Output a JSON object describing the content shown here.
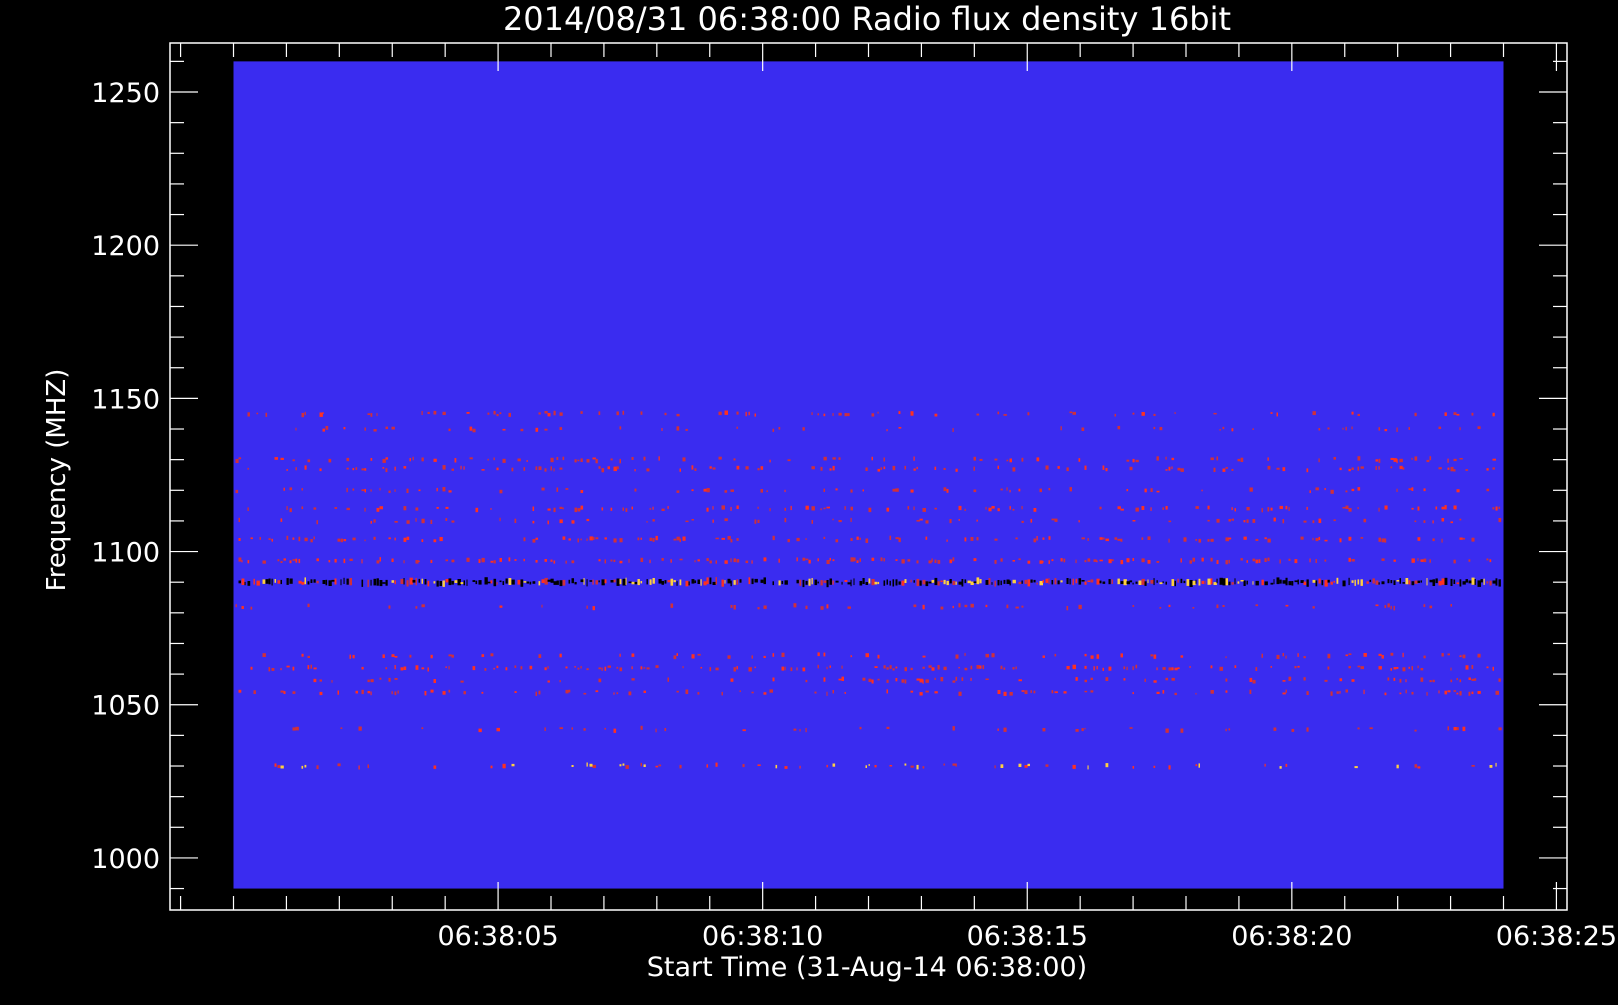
{
  "chart_data": {
    "type": "heatmap",
    "title": "2014/08/31 06:38:00 Radio flux density 16bit",
    "xlabel": "Start Time (31-Aug-14 06:38:00)",
    "ylabel": "Frequency (MHZ)",
    "x_ticks": [
      {
        "seconds": 5,
        "label": "06:38:05"
      },
      {
        "seconds": 10,
        "label": "06:38:10"
      },
      {
        "seconds": 15,
        "label": "06:38:15"
      },
      {
        "seconds": 20,
        "label": "06:38:20"
      },
      {
        "seconds": 25,
        "label": "06:38:25"
      }
    ],
    "x_minor_step_seconds": 1,
    "y_ticks": [
      1000,
      1050,
      1100,
      1150,
      1200,
      1250
    ],
    "y_minor_step": 10,
    "xlim_seconds": [
      -1.2,
      25.2
    ],
    "ylim": [
      983,
      1266
    ],
    "data_x_range_seconds": [
      0,
      24
    ],
    "data_y_range": [
      990,
      1260
    ],
    "colors": {
      "background": "#3a2cf0",
      "low": "#d0303a",
      "mid": "#ff3020",
      "high": "#ffd040",
      "saturated": "#000000",
      "axis": "#ffffff",
      "page": "#000000"
    },
    "bands": [
      {
        "freq": 1030,
        "intensity": 0.95,
        "density": 0.18
      },
      {
        "freq": 1042,
        "intensity": 0.35,
        "density": 0.1
      },
      {
        "freq": 1054,
        "intensity": 0.55,
        "density": 0.2
      },
      {
        "freq": 1058,
        "intensity": 0.45,
        "density": 0.16
      },
      {
        "freq": 1062,
        "intensity": 0.6,
        "density": 0.28
      },
      {
        "freq": 1066,
        "intensity": 0.5,
        "density": 0.18
      },
      {
        "freq": 1082,
        "intensity": 0.35,
        "density": 0.1
      },
      {
        "freq": 1090,
        "intensity": 1.0,
        "density": 0.85
      },
      {
        "freq": 1097,
        "intensity": 0.6,
        "density": 0.35
      },
      {
        "freq": 1104,
        "intensity": 0.5,
        "density": 0.28
      },
      {
        "freq": 1110,
        "intensity": 0.4,
        "density": 0.15
      },
      {
        "freq": 1114,
        "intensity": 0.55,
        "density": 0.22
      },
      {
        "freq": 1120,
        "intensity": 0.5,
        "density": 0.18
      },
      {
        "freq": 1127,
        "intensity": 0.55,
        "density": 0.26
      },
      {
        "freq": 1130,
        "intensity": 0.45,
        "density": 0.15
      },
      {
        "freq": 1140,
        "intensity": 0.35,
        "density": 0.12
      },
      {
        "freq": 1145,
        "intensity": 0.4,
        "density": 0.16
      }
    ]
  }
}
